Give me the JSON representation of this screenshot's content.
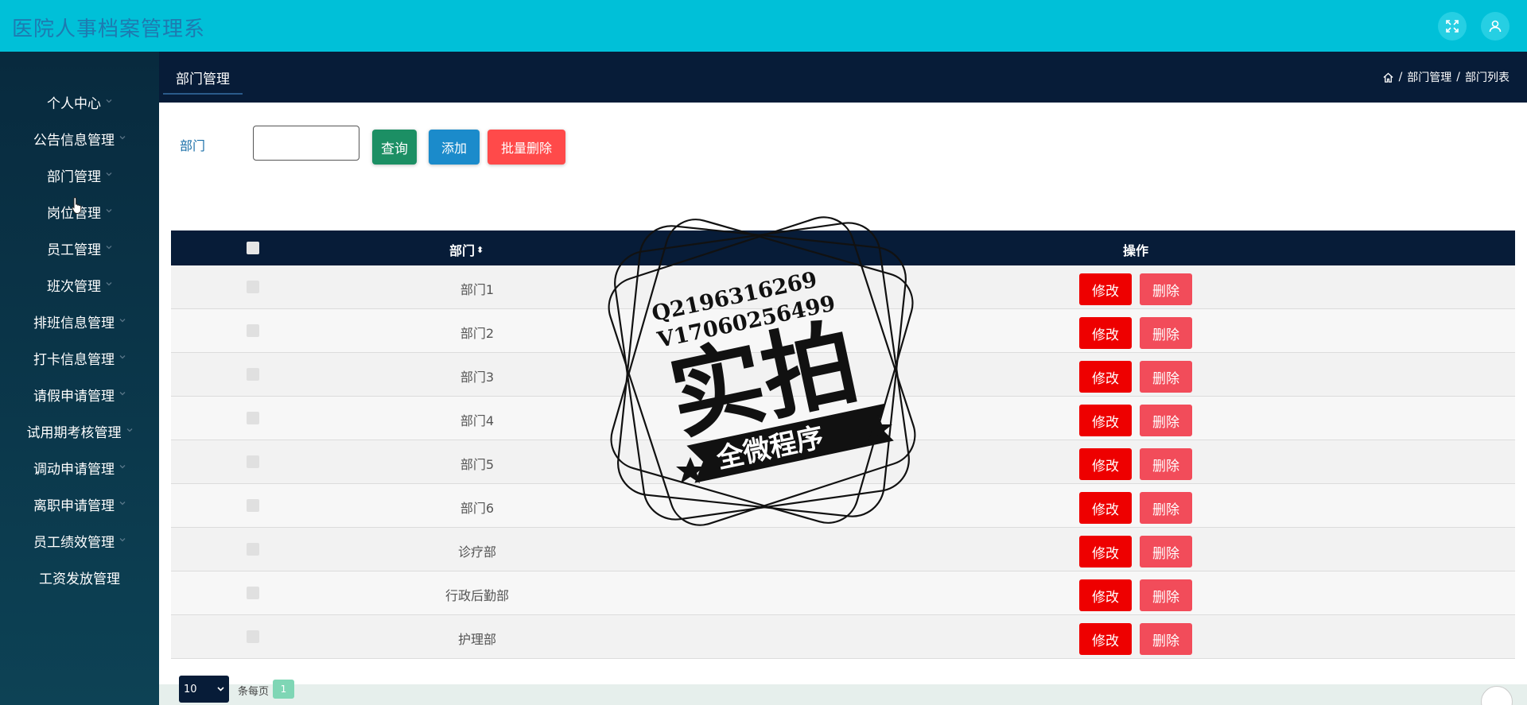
{
  "app": {
    "title": "医院人事档案管理系"
  },
  "sidebar": {
    "items": [
      {
        "label": "个人中心"
      },
      {
        "label": "公告信息管理"
      },
      {
        "label": "部门管理"
      },
      {
        "label": "岗位管理"
      },
      {
        "label": "员工管理"
      },
      {
        "label": "班次管理"
      },
      {
        "label": "排班信息管理"
      },
      {
        "label": "打卡信息管理"
      },
      {
        "label": "请假申请管理"
      },
      {
        "label": "试用期考核管理"
      },
      {
        "label": "调动申请管理"
      },
      {
        "label": "离职申请管理"
      },
      {
        "label": "员工绩效管理"
      },
      {
        "label": "工资发放管理"
      }
    ]
  },
  "subheader": {
    "tab": "部门管理",
    "breadcrumb": [
      "部门管理",
      "部门列表"
    ],
    "separator": "/"
  },
  "search": {
    "label": "部门",
    "value": "",
    "query_label": "查询",
    "add_label": "添加",
    "batch_delete_label": "批量删除"
  },
  "table": {
    "columns": [
      "部门",
      "操作"
    ],
    "sort_glyph": "⬍",
    "rows": [
      {
        "dept": "部门1"
      },
      {
        "dept": "部门2"
      },
      {
        "dept": "部门3"
      },
      {
        "dept": "部门4"
      },
      {
        "dept": "部门5"
      },
      {
        "dept": "部门6"
      },
      {
        "dept": "诊疗部"
      },
      {
        "dept": "行政后勤部"
      },
      {
        "dept": "护理部"
      }
    ],
    "edit_label": "修改",
    "delete_label": "删除"
  },
  "pager": {
    "page_size": "10",
    "per_page_label": "条每页",
    "current_page": "1"
  },
  "watermark": {
    "line1": "Q2196316269",
    "line2": "V17060256499",
    "main": "实拍",
    "ribbon": "全微程序"
  },
  "colors": {
    "topbar": "#00c0d8",
    "navy": "#071c38",
    "edit": "#ee0000",
    "delete": "#f24c5a"
  }
}
